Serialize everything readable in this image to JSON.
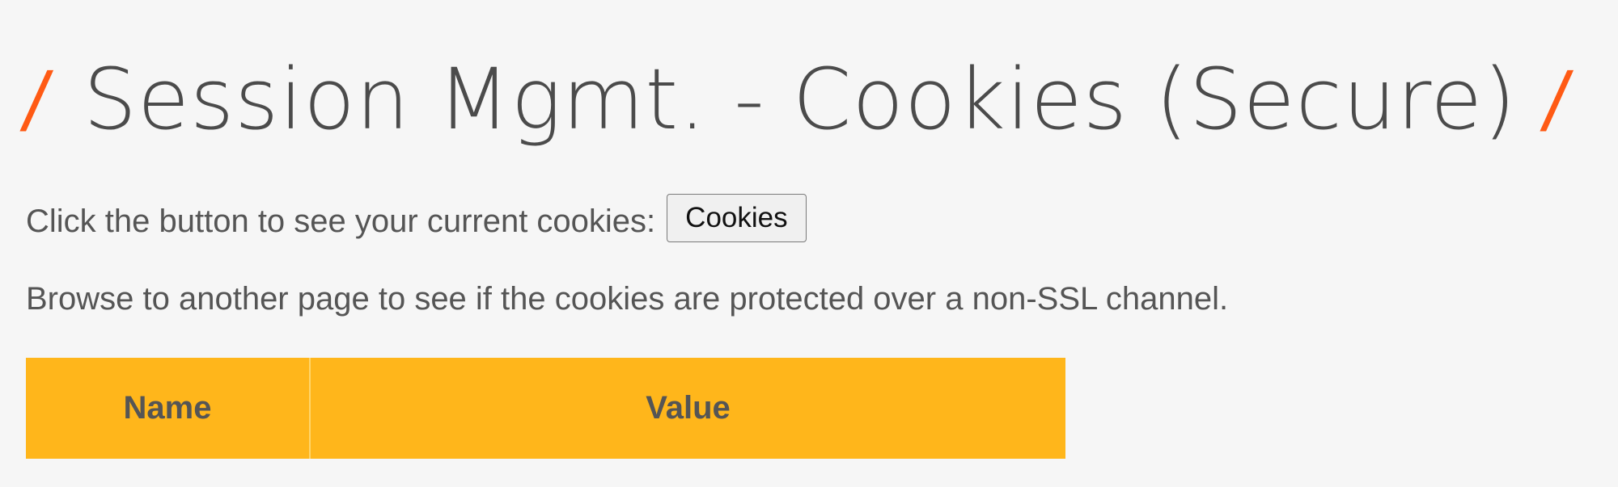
{
  "header": {
    "left_mark": "/",
    "title": "Session Mgmt. - Cookies (Secure)",
    "right_mark": "/"
  },
  "content": {
    "instruction": "Click the button to see your current cookies:",
    "cookies_button_label": "Cookies",
    "browse_note": "Browse to another page to see if the cookies are protected over a non-SSL channel."
  },
  "table": {
    "headers": [
      "Name",
      "Value"
    ]
  },
  "colors": {
    "accent": "#ff5a14",
    "table_header": "#ffb61b",
    "background": "#f6f6f6",
    "text": "#555555"
  }
}
